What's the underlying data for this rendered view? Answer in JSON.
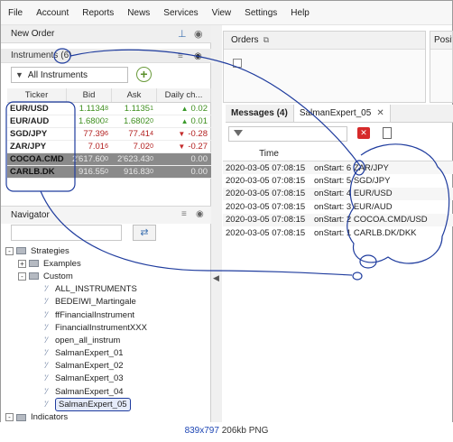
{
  "menu": [
    "File",
    "Account",
    "Reports",
    "News",
    "Services",
    "View",
    "Settings",
    "Help"
  ],
  "new_order": {
    "title": "New Order"
  },
  "instruments": {
    "title": "Instruments",
    "count": "(6)",
    "filter": "All Instruments",
    "columns": [
      "Ticker",
      "Bid",
      "Ask",
      "Daily ch..."
    ],
    "rows": [
      {
        "ticker": "EUR/USD",
        "bid": "1.1134",
        "bid_sub": "8",
        "ask": "1.1135",
        "ask_sub": "1",
        "daily": "0.02",
        "dir": "up",
        "muted": false
      },
      {
        "ticker": "EUR/AUD",
        "bid": "1.6800",
        "bid_sub": "2",
        "ask": "1.6802",
        "ask_sub": "0",
        "daily": "0.01",
        "dir": "up",
        "muted": false
      },
      {
        "ticker": "SGD/JPY",
        "bid": "77.39",
        "bid_sub": "6",
        "ask": "77.41",
        "ask_sub": "4",
        "daily": "-0.28",
        "dir": "down",
        "muted": false
      },
      {
        "ticker": "ZAR/JPY",
        "bid": "7.01",
        "bid_sub": "6",
        "ask": "7.02",
        "ask_sub": "0",
        "daily": "-0.27",
        "dir": "down",
        "muted": false
      },
      {
        "ticker": "COCOA.CMD",
        "bid": "2'617.60",
        "bid_sub": "0",
        "ask": "2'623.43",
        "ask_sub": "0",
        "daily": "0.00",
        "dir": "none",
        "muted": true
      },
      {
        "ticker": "CARLB.DK",
        "bid": "916.55",
        "bid_sub": "0",
        "ask": "916.83",
        "ask_sub": "0",
        "daily": "0.00",
        "dir": "none",
        "muted": true
      }
    ]
  },
  "navigator": {
    "title": "Navigator",
    "tree": [
      {
        "label": "Strategies",
        "type": "folder",
        "level": 0,
        "expander": "-"
      },
      {
        "label": "Examples",
        "type": "folder",
        "level": 1,
        "expander": "+"
      },
      {
        "label": "Custom",
        "type": "folder",
        "level": 1,
        "expander": "-"
      },
      {
        "label": "ALL_INSTRUMENTS",
        "type": "file",
        "level": 2
      },
      {
        "label": "BEDEIWI_Martingale",
        "type": "file",
        "level": 2
      },
      {
        "label": "ffFinancialInstrument",
        "type": "file",
        "level": 2
      },
      {
        "label": "FinancialInstrumentXXX",
        "type": "file",
        "level": 2
      },
      {
        "label": "open_all_instrum",
        "type": "file",
        "level": 2
      },
      {
        "label": "SalmanExpert_01",
        "type": "file",
        "level": 2
      },
      {
        "label": "SalmanExpert_02",
        "type": "file",
        "level": 2
      },
      {
        "label": "SalmanExpert_03",
        "type": "file",
        "level": 2
      },
      {
        "label": "SalmanExpert_04",
        "type": "file",
        "level": 2
      },
      {
        "label": "SalmanExpert_05",
        "type": "file",
        "level": 2,
        "selected": true
      },
      {
        "label": "Indicators",
        "type": "folder",
        "level": 0,
        "expander": "-"
      },
      {
        "label": "Common",
        "type": "folder",
        "level": 1,
        "expander": "+"
      }
    ]
  },
  "orders": {
    "title": "Orders"
  },
  "positions": {
    "title": "Positi"
  },
  "messages": {
    "tab_label": "Messages (4)",
    "strategy_tab": "SalmanExpert_05",
    "column_time": "Time",
    "rows": [
      {
        "time": "2020-03-05 07:08:15",
        "msg": "onStart: 6  ZAR/JPY"
      },
      {
        "time": "2020-03-05 07:08:15",
        "msg": "onStart: 5  SGD/JPY"
      },
      {
        "time": "2020-03-05 07:08:15",
        "msg": "onStart: 4  EUR/USD"
      },
      {
        "time": "2020-03-05 07:08:15",
        "msg": "onStart: 3  EUR/AUD"
      },
      {
        "time": "2020-03-05 07:08:15",
        "msg": "onStart: 2  COCOA.CMD/USD"
      },
      {
        "time": "2020-03-05 07:08:15",
        "msg": "onStart: 1  CARLB.DK/DKK"
      }
    ]
  },
  "caption": {
    "dims": "839x797",
    "size": "206kb",
    "format": "PNG"
  },
  "colors": {
    "annotation": "#1f3c9e",
    "up": "#3f8f1f",
    "down": "#b32020"
  }
}
